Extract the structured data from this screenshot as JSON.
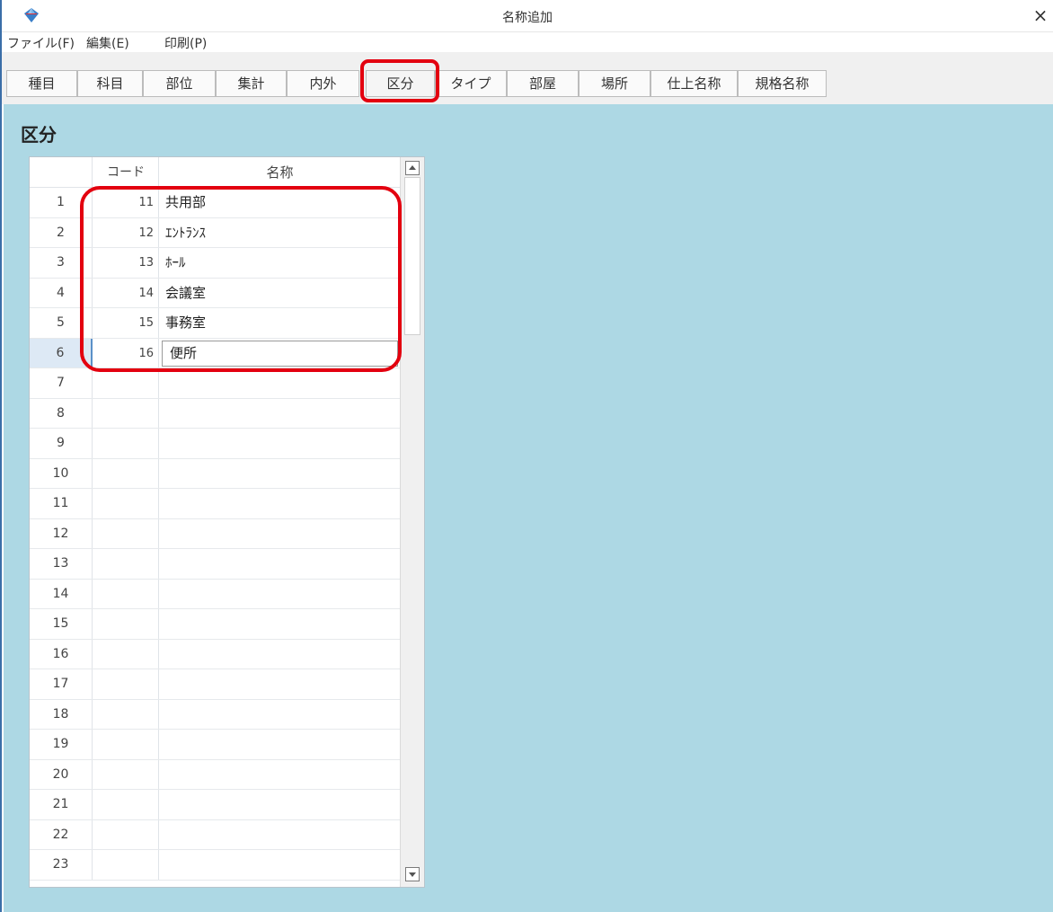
{
  "window": {
    "title": "名称追加",
    "close_label": "×"
  },
  "menu": [
    "ファイル(F)",
    "編集(E)",
    "印刷(P)"
  ],
  "tabs": [
    "種目",
    "科目",
    "部位",
    "集計",
    "内外",
    "区分",
    "タイプ",
    "部屋",
    "場所",
    "仕上名称",
    "規格名称"
  ],
  "active_tab": "区分",
  "section_title": "区分",
  "grid": {
    "headers": {
      "code": "コード",
      "name": "名称"
    },
    "current_row": 6,
    "rows": [
      {
        "num": "1",
        "code": "11",
        "name": "共用部"
      },
      {
        "num": "2",
        "code": "12",
        "name": "ｴﾝﾄﾗﾝｽ"
      },
      {
        "num": "3",
        "code": "13",
        "name": "ﾎｰﾙ"
      },
      {
        "num": "4",
        "code": "14",
        "name": "会議室"
      },
      {
        "num": "5",
        "code": "15",
        "name": "事務室"
      },
      {
        "num": "6",
        "code": "16",
        "name": "便所"
      },
      {
        "num": "7",
        "code": "",
        "name": ""
      },
      {
        "num": "8",
        "code": "",
        "name": ""
      },
      {
        "num": "9",
        "code": "",
        "name": ""
      },
      {
        "num": "10",
        "code": "",
        "name": ""
      },
      {
        "num": "11",
        "code": "",
        "name": ""
      },
      {
        "num": "12",
        "code": "",
        "name": ""
      },
      {
        "num": "13",
        "code": "",
        "name": ""
      },
      {
        "num": "14",
        "code": "",
        "name": ""
      },
      {
        "num": "15",
        "code": "",
        "name": ""
      },
      {
        "num": "16",
        "code": "",
        "name": ""
      },
      {
        "num": "17",
        "code": "",
        "name": ""
      },
      {
        "num": "18",
        "code": "",
        "name": ""
      },
      {
        "num": "19",
        "code": "",
        "name": ""
      },
      {
        "num": "20",
        "code": "",
        "name": ""
      },
      {
        "num": "21",
        "code": "",
        "name": ""
      },
      {
        "num": "22",
        "code": "",
        "name": ""
      },
      {
        "num": "23",
        "code": "",
        "name": ""
      }
    ]
  },
  "colors": {
    "background": "#add8e4",
    "highlight": "#e3000f",
    "accent": "#3a6ea8"
  },
  "icons": {
    "app": "app-logo-icon",
    "close": "close-icon",
    "scroll_up": "arrow-up-icon",
    "scroll_down": "arrow-down-icon"
  }
}
